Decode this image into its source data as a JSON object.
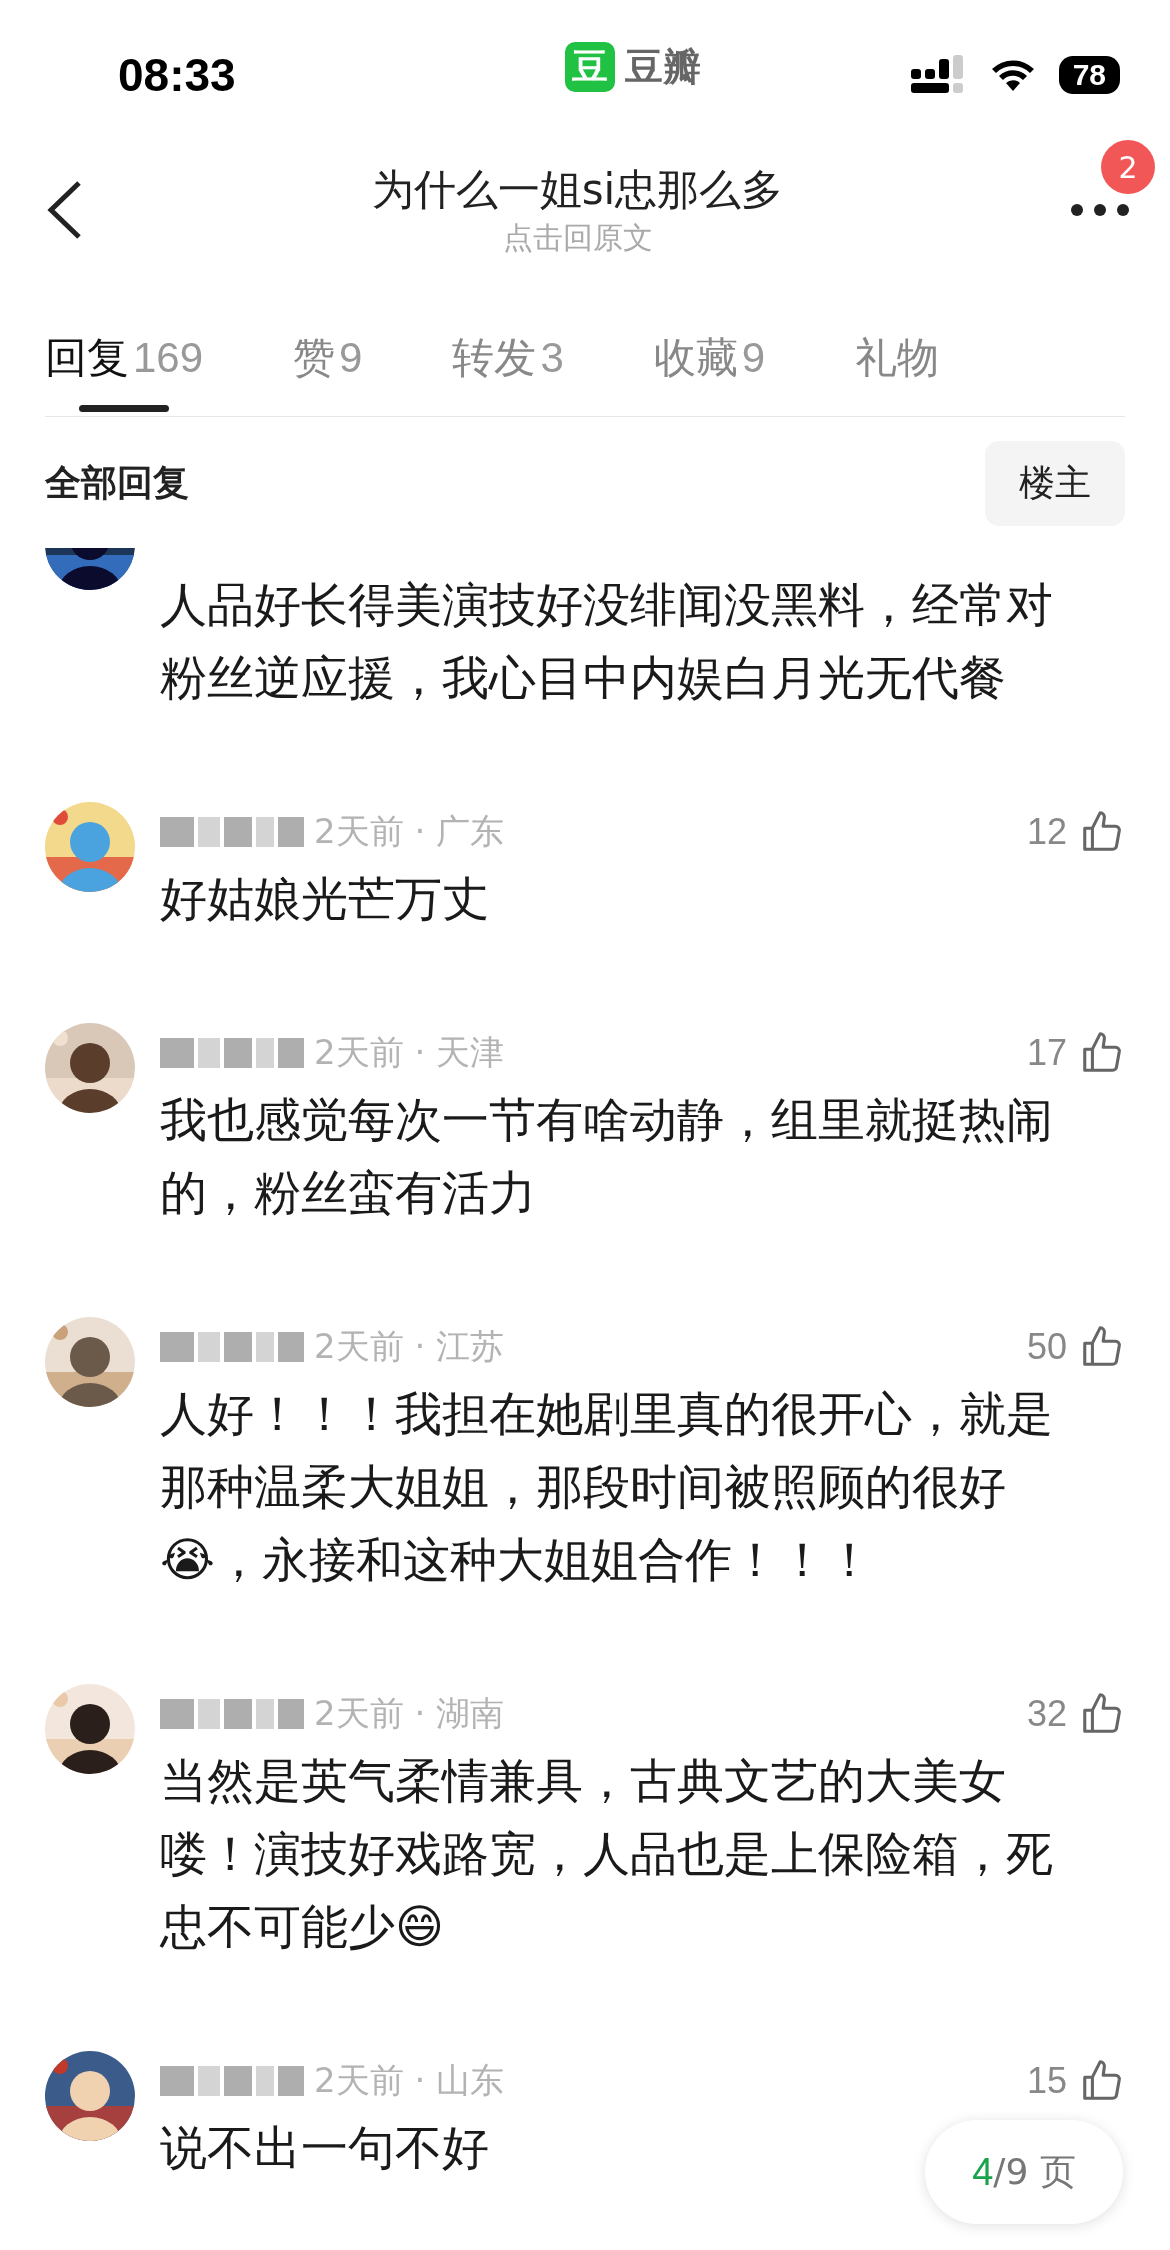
{
  "status_bar": {
    "time": "08:33",
    "app_logo": "豆",
    "app_name": "豆瓣",
    "battery": "78"
  },
  "header": {
    "title": "为什么一姐si忠那么多",
    "subtitle": "点击回原文",
    "badge": "2"
  },
  "tabs": [
    {
      "label": "回复",
      "count": "169",
      "selected": true
    },
    {
      "label": "赞",
      "count": "9",
      "selected": false
    },
    {
      "label": "转发",
      "count": "3",
      "selected": false
    },
    {
      "label": "收藏",
      "count": "9",
      "selected": false
    },
    {
      "label": "礼物",
      "selected": false
    }
  ],
  "section": {
    "title": "全部回复",
    "filter_button": "楼主"
  },
  "comments": [
    {
      "cut": true,
      "text": "人品好长得美演技好没绯闻没黑料，经常对粉丝逆应援，我心目中内娱白月光无代餐"
    },
    {
      "meta": "2天前 · 广东",
      "likes": "12",
      "text": "好姑娘光芒万丈"
    },
    {
      "meta": "2天前 · 天津",
      "likes": "17",
      "text": "我也感觉每次一节有啥动静，组里就挺热闹的，粉丝蛮有活力"
    },
    {
      "meta": "2天前 · 江苏",
      "likes": "50",
      "text": "人好！！！我担在她剧里真的很开心，就是那种温柔大姐姐，那段时间被照顾的很好😭，永接和这种大姐姐合作！！！"
    },
    {
      "meta": "2天前 · 湖南",
      "likes": "32",
      "text": "当然是英气柔情兼具，古典文艺的大美女喽！演技好戏路宽，人品也是上保险箱，死忠不可能少😄"
    },
    {
      "meta": "2天前 · 山东",
      "likes": "15",
      "text": "说不出一句不好"
    }
  ],
  "pager": {
    "current": "4",
    "rest": "/9 页"
  }
}
